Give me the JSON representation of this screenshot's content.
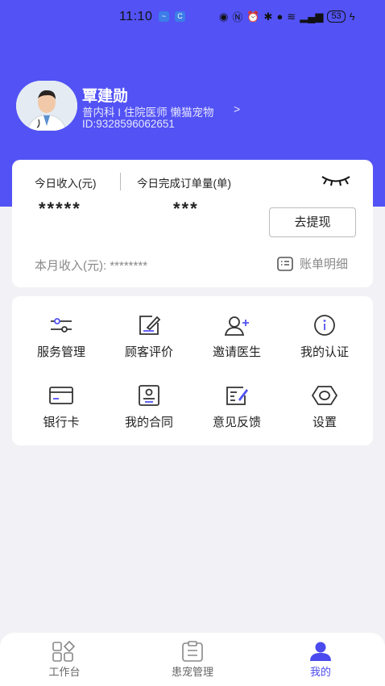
{
  "status_bar": {
    "time": "11:10",
    "battery": "53"
  },
  "profile": {
    "name": "覃建勋",
    "department": "普内科 I 住院医师  懒猫宠物",
    "id_text": "ID:9328596062651"
  },
  "income": {
    "today_income_label": "今日收入(元)",
    "today_orders_label": "今日完成订单量(单)",
    "today_income_value": "*****",
    "today_orders_value": "***",
    "withdraw_label": "去提现",
    "month_label": "本月收入(元): ********",
    "bill_label": "账单明细"
  },
  "menu": {
    "items": [
      {
        "label": "服务管理",
        "icon": "sliders-icon"
      },
      {
        "label": "顾客评价",
        "icon": "edit-note-icon"
      },
      {
        "label": "邀请医生",
        "icon": "add-user-icon"
      },
      {
        "label": "我的认证",
        "icon": "info-icon"
      },
      {
        "label": "银行卡",
        "icon": "card-icon"
      },
      {
        "label": "我的合同",
        "icon": "contract-icon"
      },
      {
        "label": "意见反馈",
        "icon": "feedback-icon"
      },
      {
        "label": "设置",
        "icon": "hexagon-icon"
      }
    ]
  },
  "tabbar": {
    "tabs": [
      {
        "label": "工作台",
        "icon": "dashboard-icon"
      },
      {
        "label": "患宠管理",
        "icon": "clipboard-icon"
      },
      {
        "label": "我的",
        "icon": "person-icon"
      }
    ],
    "active_index": 2
  },
  "colors": {
    "brand": "#5252f5",
    "active_tab": "#4a4aee",
    "background": "#f2f2f6"
  }
}
